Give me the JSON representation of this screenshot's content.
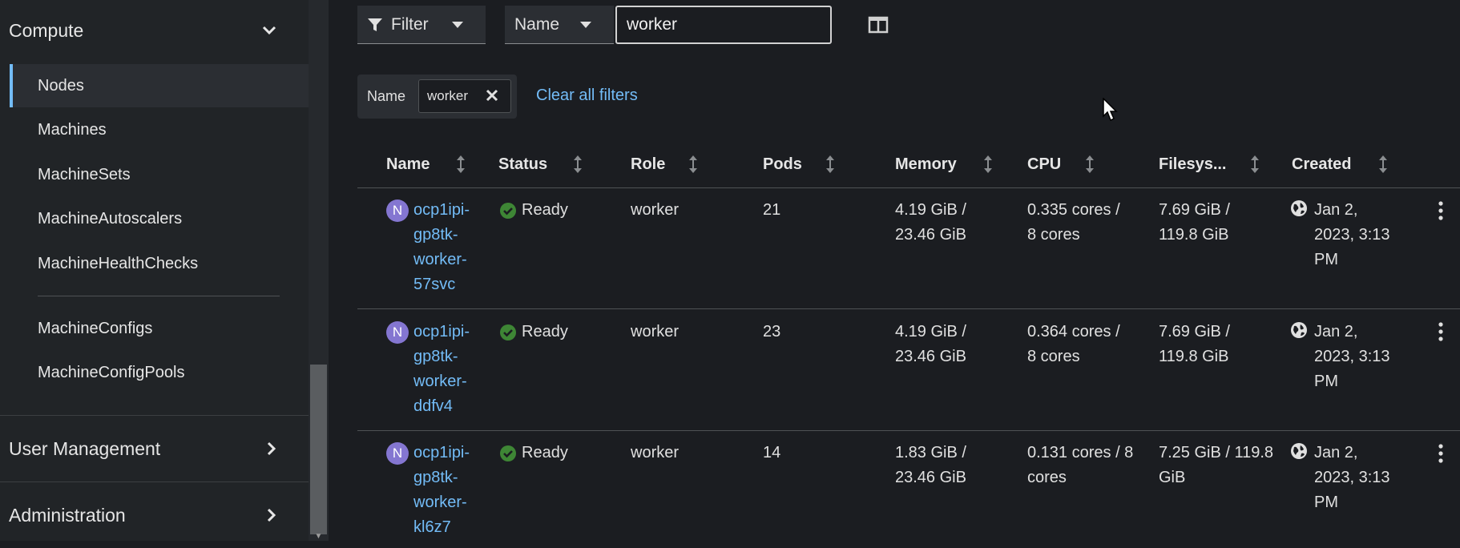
{
  "sidebar": {
    "compute_label": "Compute",
    "items": [
      {
        "label": "Nodes",
        "active": true
      },
      {
        "label": "Machines"
      },
      {
        "label": "MachineSets"
      },
      {
        "label": "MachineAutoscalers"
      },
      {
        "label": "MachineHealthChecks"
      },
      {
        "label": "MachineConfigs"
      },
      {
        "label": "MachineConfigPools"
      }
    ],
    "user_management_label": "User Management",
    "administration_label": "Administration"
  },
  "toolbar": {
    "filter_label": "Filter",
    "name_select": "Name",
    "search_value": "worker"
  },
  "active_filters": {
    "category": "Name",
    "chip": "worker",
    "clear_label": "Clear all filters"
  },
  "table": {
    "columns": [
      "Name",
      "Status",
      "Role",
      "Pods",
      "Memory",
      "CPU",
      "Filesys...",
      "Created"
    ],
    "badge": "N",
    "rows": [
      {
        "name": [
          "ocp1ipi-",
          "gp8tk-",
          "worker-",
          "57svc"
        ],
        "status": "Ready",
        "role": "worker",
        "pods": "21",
        "memory": [
          "4.19 GiB /",
          "23.46 GiB"
        ],
        "cpu": [
          "0.335 cores /",
          "8 cores"
        ],
        "filesystem": [
          "7.69 GiB /",
          "119.8 GiB"
        ],
        "created": [
          "Jan 2,",
          "2023, 3:13",
          "PM"
        ]
      },
      {
        "name": [
          "ocp1ipi-",
          "gp8tk-",
          "worker-",
          "ddfv4"
        ],
        "status": "Ready",
        "role": "worker",
        "pods": "23",
        "memory": [
          "4.19 GiB /",
          "23.46 GiB"
        ],
        "cpu": [
          "0.364 cores /",
          "8 cores"
        ],
        "filesystem": [
          "7.69 GiB /",
          "119.8 GiB"
        ],
        "created": [
          "Jan 2,",
          "2023, 3:13",
          "PM"
        ]
      },
      {
        "name": [
          "ocp1ipi-",
          "gp8tk-",
          "worker-",
          "kl6z7"
        ],
        "status": "Ready",
        "role": "worker",
        "pods": "14",
        "memory": [
          "1.83 GiB /",
          "23.46 GiB"
        ],
        "cpu": [
          "0.131 cores / 8",
          "cores"
        ],
        "filesystem": [
          "7.25 GiB / 119.8",
          "GiB"
        ],
        "created": [
          "Jan 2,",
          "2023, 3:13",
          "PM"
        ]
      }
    ]
  },
  "colors": {
    "background": "#1b1d21",
    "sidebar": "#212427",
    "link": "#73bcf7",
    "ready": "#3e8635",
    "node_badge": "#8476d1"
  }
}
